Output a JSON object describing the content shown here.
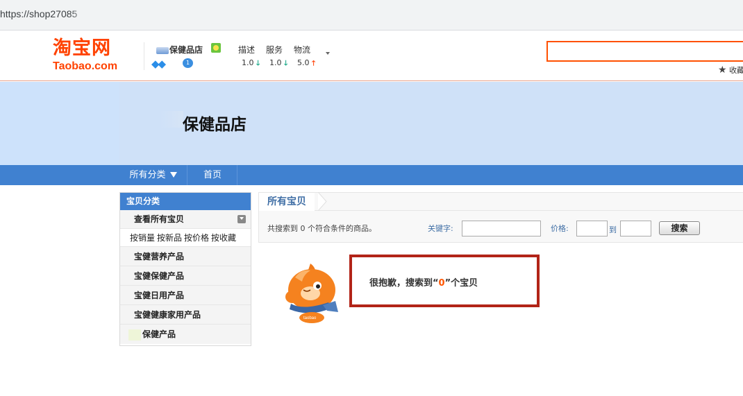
{
  "browser": {
    "url": "https://shop27085"
  },
  "header": {
    "logo_cn": "淘宝网",
    "logo_en": "Taobao.com",
    "shop_name": "保健品店",
    "badge_number": "1",
    "ratings": [
      {
        "label": "描述",
        "score": "1.0",
        "trend": "down"
      },
      {
        "label": "服务",
        "score": "1.0",
        "trend": "down"
      },
      {
        "label": "物流",
        "score": "5.0",
        "trend": "up"
      }
    ],
    "favorite_label": "收藏"
  },
  "banner": {
    "title": "保健品店"
  },
  "nav": {
    "all_categories": "所有分类",
    "home": "首页"
  },
  "sidebar": {
    "heading": "宝贝分类",
    "view_all": "查看所有宝贝",
    "sorts": [
      "按销量",
      "按新品",
      "按价格",
      "按收藏"
    ],
    "categories": [
      "宝健营养产品",
      "宝健保健产品",
      "宝健日用产品",
      "宝健健康家用产品",
      "保健产品"
    ]
  },
  "main": {
    "tab_title": "所有宝贝",
    "result_count_text": "共搜索到 0 个符合条件的商品。",
    "keyword_label": "关键字:",
    "keyword_value": "",
    "price_label": "价格:",
    "price_to": "到",
    "search_button": "搜索",
    "empty_prefix": "很抱歉，搜索到“",
    "empty_count": "0",
    "empty_suffix": "”个宝贝"
  },
  "colors": {
    "accent": "#ff5000",
    "nav_blue": "#4081d0",
    "banner_bg": "#cde2fb",
    "notice_border": "#b22418"
  }
}
